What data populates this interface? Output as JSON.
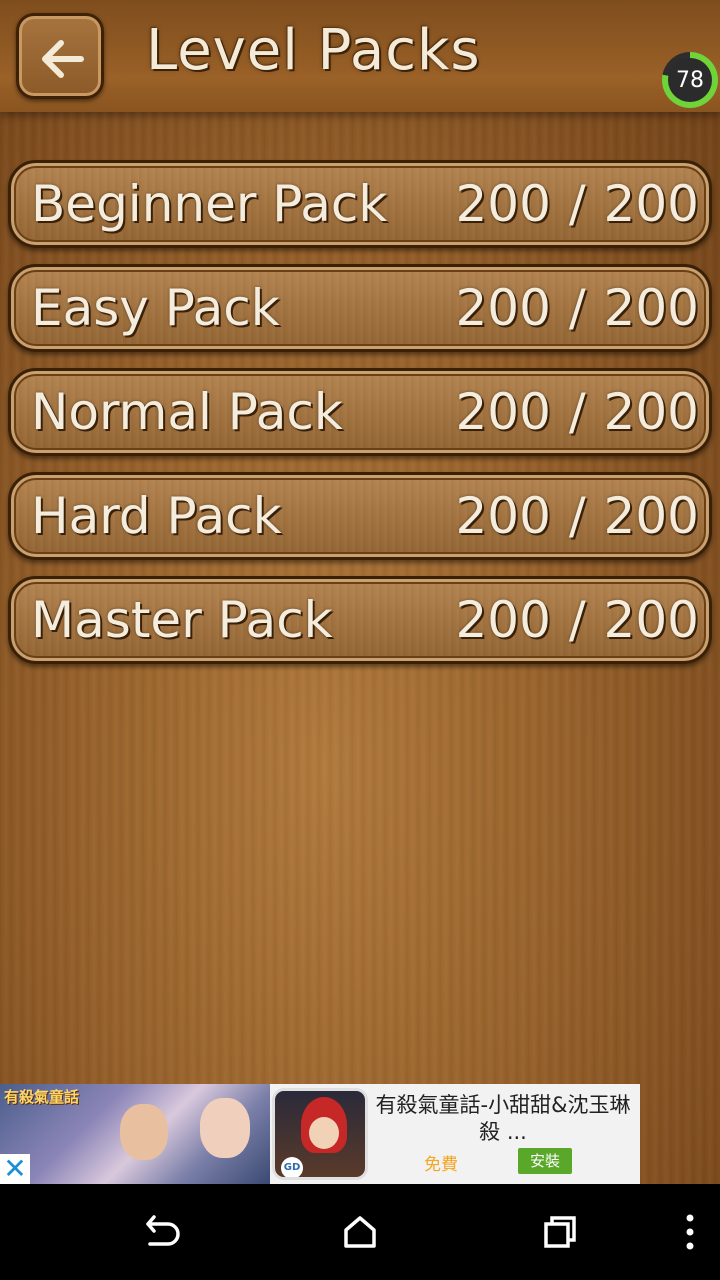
{
  "header": {
    "title": "Level Packs",
    "score": "78",
    "score_fraction": 0.78,
    "back_icon": "arrow-left-icon"
  },
  "packs": [
    {
      "name": "Beginner Pack",
      "progress": "200 / 200"
    },
    {
      "name": "Easy Pack",
      "progress": "200 / 200"
    },
    {
      "name": "Normal Pack",
      "progress": "200 / 200"
    },
    {
      "name": "Hard Pack",
      "progress": "200 / 200"
    },
    {
      "name": "Master Pack",
      "progress": "200 / 200"
    }
  ],
  "ad": {
    "title": "有殺氣童話-小甜甜&沈玉琳殺 ...",
    "free_label": "免費",
    "install_label": "安裝",
    "close_label": "✕",
    "logo_text": "有殺氣童話",
    "icon_badge": "GD"
  },
  "navbar": {
    "icons": [
      "back-icon",
      "home-icon",
      "recents-icon",
      "overflow-menu-icon"
    ]
  },
  "colors": {
    "wood": "#96602a",
    "text": "#f4ecdd",
    "badge_ring": "#6fd33a",
    "install": "#5aa82a",
    "free": "#f5a623"
  }
}
